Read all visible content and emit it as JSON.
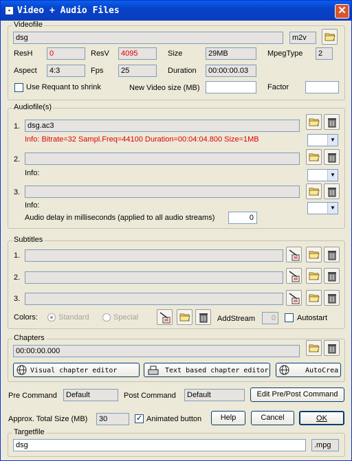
{
  "window": {
    "title": "Video + Audio Files",
    "close_icon": "close-icon"
  },
  "videofile": {
    "caption": "Videofile",
    "filename": "dsg",
    "ext": "m2v",
    "resh_label": "ResH",
    "resh": "0",
    "resv_label": "ResV",
    "resv": "4095",
    "size_label": "Size",
    "size": "29MB",
    "mpegtype_label": "MpegType",
    "mpegtype": "2",
    "aspect_label": "Aspect",
    "aspect": "4:3",
    "fps_label": "Fps",
    "fps": "25",
    "duration_label": "Duration",
    "duration": "00:00:00.03",
    "shrink_label": "Use Requant to shrink",
    "newsize_label": "New Video size (MB)",
    "newsize": "",
    "factor_label": "Factor",
    "factor": ""
  },
  "audio": {
    "caption": "Audiofile(s)",
    "items": [
      {
        "num": "1.",
        "file": "dsg.ac3",
        "info": "Info: Bitrate=32  Sampl.Freq=44100  Duration=00:04:04.800  Size=1MB"
      },
      {
        "num": "2.",
        "file": "",
        "info": "Info:"
      },
      {
        "num": "3.",
        "file": "",
        "info": "Info:"
      }
    ],
    "delay_label": "Audio delay in milliseconds (applied to all audio streams)",
    "delay": "0"
  },
  "subtitles": {
    "caption": "Subtitles",
    "items": [
      {
        "num": "1.",
        "file": ""
      },
      {
        "num": "2.",
        "file": ""
      },
      {
        "num": "3.",
        "file": ""
      }
    ],
    "colors_label": "Colors:",
    "standard_label": "Standard",
    "special_label": "Special",
    "addstream_label": "AddStream",
    "addstream": "0",
    "autostart_label": "Autostart"
  },
  "chapters": {
    "caption": "Chapters",
    "value": "00:00:00.000",
    "visual_editor": "Visual chapter editor",
    "text_editor": "Text based chapter editor",
    "autocrea": "AutoCrea"
  },
  "commands": {
    "pre_label": "Pre Command",
    "pre": "Default",
    "post_label": "Post Command",
    "post": "Default",
    "edit_button": "Edit Pre/Post Command"
  },
  "bottom": {
    "total_label": "Approx. Total Size (MB)",
    "total": "30",
    "animated_label": "Animated button",
    "help": "Help",
    "cancel": "Cancel",
    "ok": "OK"
  },
  "targetfile": {
    "caption": "Targetfile",
    "filename": "dsg",
    "ext": ".mpg"
  },
  "colors": {
    "title_blue": "#0842c8",
    "red_text": "#e00000",
    "face": "#ece9d8"
  }
}
